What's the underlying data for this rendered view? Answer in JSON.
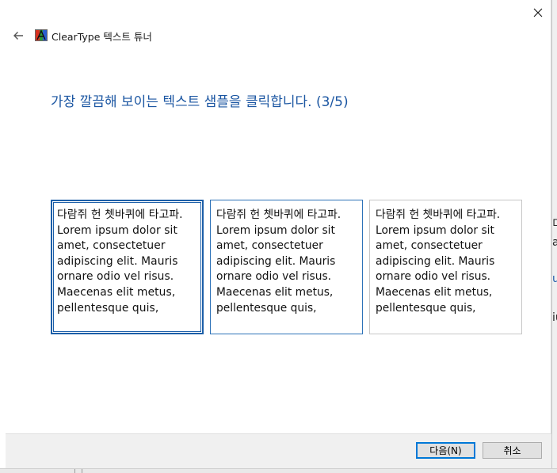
{
  "window": {
    "app_title": "ClearType 텍스트 튜너",
    "close_glyph": "✕",
    "back_glyph": "←"
  },
  "main": {
    "instruction": "가장 깔끔해 보이는 텍스트 샘플을 클릭합니다. (3/5)",
    "samples": [
      {
        "text": "다람쥐 헌 쳇바퀴에 타고파. Lorem ipsum dolor sit amet, consectetuer adipiscing elit. Mauris ornare odio vel risus. Maecenas elit metus, pellentesque quis,",
        "state": "selected"
      },
      {
        "text": "다람쥐 헌 쳇바퀴에 타고파. Lorem ipsum dolor sit amet, consectetuer adipiscing elit. Mauris ornare odio vel risus. Maecenas elit metus, pellentesque quis,",
        "state": "hover"
      },
      {
        "text": "다람쥐 헌 쳇바퀴에 타고파. Lorem ipsum dolor sit amet, consectetuer adipiscing elit. Mauris ornare odio vel risus. Maecenas elit metus, pellentesque quis,",
        "state": "normal"
      }
    ]
  },
  "footer": {
    "next_label": "다음(N)",
    "cancel_label": "취소"
  },
  "background_window": {
    "fragments": [
      "디",
      "a",
      "u",
      "iu"
    ]
  },
  "colors": {
    "instruction": "#1b56a2",
    "selected_border": "#1d5fa8",
    "default_button_border": "#0078d7",
    "footer_bg": "#f0f0f0"
  },
  "icons": {
    "app": "cleartype-icon",
    "back": "back-arrow-icon",
    "close": "close-icon"
  }
}
